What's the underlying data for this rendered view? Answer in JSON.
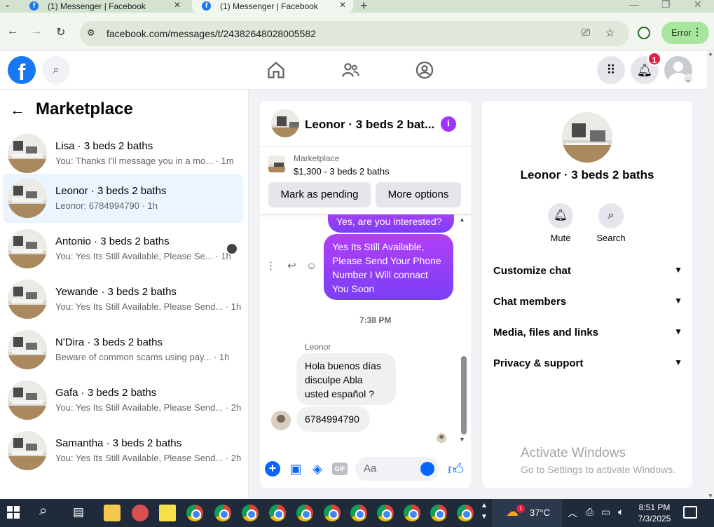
{
  "browser": {
    "tabs": [
      {
        "title": "(1) Messenger | Facebook",
        "close": "✕"
      },
      {
        "title": "(1) Messenger | Facebook",
        "close": "✕"
      }
    ],
    "new_tab": "+",
    "url": "facebook.com/messages/t/24382648028005582",
    "error_label": "Error"
  },
  "fb_header": {
    "logo": "f",
    "notification_count": "1"
  },
  "left_panel": {
    "title": "Marketplace",
    "conversations": [
      {
        "name": "Lisa · 3 beds 2 baths",
        "snippet": "You: Thanks I'll message you in a mo... · 1m",
        "active": false
      },
      {
        "name": "Leonor · 3 beds 2 baths",
        "snippet": "Leonor: 6784994790 · 1h",
        "active": true
      },
      {
        "name": "Antonio · 3 beds 2 baths",
        "snippet": "You: Yes Its Still Available, Please Se... · 1h",
        "active": false
      },
      {
        "name": "Yewande · 3 beds 2 baths",
        "snippet": "You: Yes Its Still Available, Please Send... · 1h",
        "active": false
      },
      {
        "name": "N'Dira · 3 beds 2 baths",
        "snippet": "Beware of common scams using pay... · 1h",
        "active": false
      },
      {
        "name": "Gafa · 3 beds 2 baths",
        "snippet": "You: Yes Its Still Available, Please Send... · 2h",
        "active": false
      },
      {
        "name": "Samantha · 3 beds 2 baths",
        "snippet": "You: Yes Its Still Available, Please Send... · 2h",
        "active": false
      }
    ]
  },
  "chat": {
    "title": "Leonor · 3 beds 2 bat...",
    "info": "i",
    "listing": {
      "source": "Marketplace",
      "price_line": "$1,300 - 3 beds 2 baths",
      "mark_pending": "Mark as pending",
      "more_options": "More options"
    },
    "messages": {
      "out1": "Yes, are you interested?",
      "out2": "Yes Its Still Available, Please Send Your Phone Number I Will connact You Soon",
      "timestamp": "7:38 PM",
      "sender": "Leonor",
      "in1": "Hola buenos días disculpe Abla usted español ?",
      "in2": "6784994790"
    },
    "composer": {
      "placeholder": "Aa",
      "gif": "GIF"
    }
  },
  "right_panel": {
    "name": "Leonor · 3 beds 2 baths",
    "actions": [
      {
        "label": "Mute",
        "icon": "bell-icon"
      },
      {
        "label": "Search",
        "icon": "search-icon"
      }
    ],
    "sections": [
      "Customize chat",
      "Chat members",
      "Media, files and links",
      "Privacy & support"
    ],
    "watermark_title": "Activate Windows",
    "watermark_sub": "Go to Settings to activate Windows."
  },
  "taskbar": {
    "temperature": "37°C",
    "time": "8:51 PM",
    "date": "7/3/2025",
    "weather_badge": "1"
  }
}
